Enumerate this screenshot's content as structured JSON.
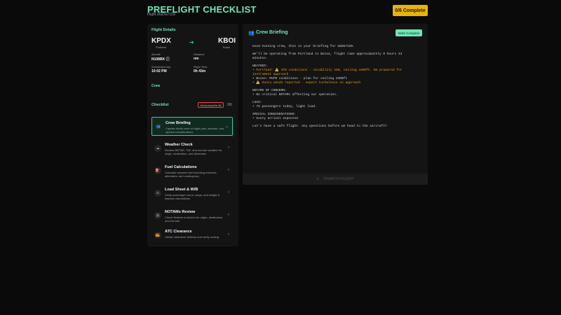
{
  "header": {
    "title": "PREFLIGHT CHECKLIST",
    "subtitle": "Flight UGDG7159",
    "progress": "0/6 Complete"
  },
  "flight": {
    "section_title": "Flight Details",
    "origin": {
      "code": "KPDX",
      "city": "Portland"
    },
    "destination": {
      "code": "KBOI",
      "city": "Boise"
    },
    "fields": [
      {
        "label": "Aircraft",
        "value": "N108BK ⓘ"
      },
      {
        "label": "Distance",
        "value": "nm"
      },
      {
        "label": "Scheduled Dep",
        "value": "10:02 PM"
      },
      {
        "label": "Flight Time",
        "value": "0h 43m"
      }
    ],
    "crew_link": "Crew"
  },
  "checklist": {
    "title": "Checklist",
    "autocomplete_label": "Autocomplete All",
    "count": "0/6",
    "items": [
      {
        "title": "Crew Briefing",
        "desc": "Captain briefs crew on flight plan, weather, and special considerations",
        "icon": "users-icon",
        "active": true
      },
      {
        "title": "Weather Check",
        "desc": "Review METAR, TAF, and enroute weather for origin, destination, and alternates",
        "icon": "cloud-icon",
        "active": false
      },
      {
        "title": "Fuel Calculations",
        "desc": "Calculate required fuel including reserves, alternates, and contingency",
        "icon": "fuel-icon",
        "active": false
      },
      {
        "title": "Load Sheet & W/B",
        "desc": "Verify passenger count, cargo, and weight & balance calculations",
        "icon": "scale-icon",
        "active": false
      },
      {
        "title": "NOTAMs Review",
        "desc": "Check Notices to Airmen for origin, destination, and enroute",
        "icon": "document-icon",
        "active": false
      },
      {
        "title": "ATC Clearance",
        "desc": "Obtain clearance delivery and verify routing",
        "icon": "radio-icon",
        "active": false
      }
    ]
  },
  "briefing": {
    "title": "Crew Briefing",
    "mark_complete": "Mark Complete",
    "lines": [
      {
        "text": "Good evening crew, this is your briefing for UGDG7159.",
        "style": ""
      },
      {
        "text": "",
        "style": "gap"
      },
      {
        "text": "We'll be operating from Portland to Boise, flight time approximately 0 hours 43",
        "style": ""
      },
      {
        "text": "minutes.",
        "style": ""
      },
      {
        "text": "",
        "style": "gap"
      },
      {
        "text": "WEATHER:",
        "style": ""
      },
      {
        "text": "• Portland: ⚠️ IFR conditions - visibility 150, ceiling 4400ft. Be prepared for",
        "style": "amber"
      },
      {
        "text": "instrument approach",
        "style": "amber"
      },
      {
        "text": "• Boise: MVFR conditions - plan for ceiling 2300ft",
        "style": ""
      },
      {
        "text": "• ⚠️ Gusty winds reported - expect turbulence on approach",
        "style": "amber"
      },
      {
        "text": "",
        "style": "gap"
      },
      {
        "text": "NOTAMS OF CONCERN:",
        "style": ""
      },
      {
        "text": "• No critical NOTAMs affecting our operation.",
        "style": ""
      },
      {
        "text": "",
        "style": "gap"
      },
      {
        "text": "LOAD:",
        "style": ""
      },
      {
        "text": "• 75 passengers today, light load.",
        "style": ""
      },
      {
        "text": "",
        "style": "gap"
      },
      {
        "text": "SPECIAL CONSIDERATIONS:",
        "style": ""
      },
      {
        "text": "• Gusty arrival expected",
        "style": ""
      },
      {
        "text": "",
        "style": "gap"
      },
      {
        "text": "Let's have a safe flight. Any questions before we head to the aircraft?",
        "style": ""
      }
    ]
  },
  "dispatch": {
    "label": "DISPATCH FLIGHT",
    "icon": "plane-icon"
  },
  "colors": {
    "accent": "#6ee7b7",
    "warning": "#eab308",
    "danger": "#ef4444",
    "amber_text": "#f59e0b"
  }
}
